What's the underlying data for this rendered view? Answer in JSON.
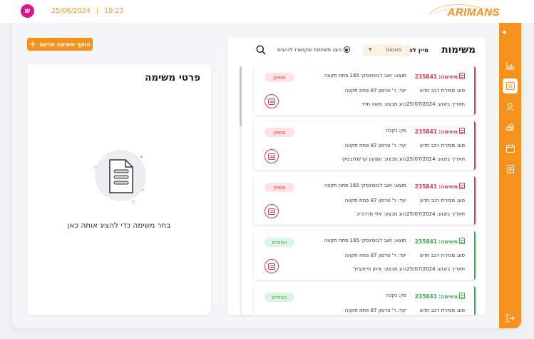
{
  "header": {
    "avatar_initial": "ש",
    "date": "25/06/2024",
    "separator": "|",
    "time": "10:23",
    "logo_text": "ARIMANS"
  },
  "actions": {
    "add_task_label": "הוסף משימה חדשה"
  },
  "details": {
    "title": "פרטי משימה",
    "empty_text": "בחר משימה כדי להציג אותה כאן"
  },
  "list": {
    "title": "משימות",
    "sort_label": "מיין לפי",
    "sort_value": "סטטוס",
    "radio_label": "הצג משימות שקושרו לנהגים"
  },
  "tasks": [
    {
      "task_label": "משימה:",
      "task_number": "235841",
      "from": "מוצא: זאב ז'בוטינסקי 165 פתח תקווה",
      "type": "סוג: מסירת רכב חדש",
      "to": "יעד: ר' טרפון 87 פתח תקווה",
      "date": "תאריך ביצוע: 25/07/2024",
      "driver": "נהג מבצע: משה חדד",
      "status": "ממתין",
      "state": "pending"
    },
    {
      "task_label": "משימה:",
      "task_number": "235841",
      "from": "מין: נקכה",
      "type": "סוג: מסירת רכב חדש",
      "to": "יעד: ר' טרפון 87 פתח תקווה",
      "date": "תאריך ביצוע: 25/07/2024",
      "driver": "נהג מבצע: שמעון קרימלובסקי",
      "status": "ממתין",
      "state": "pending"
    },
    {
      "task_label": "משימה:",
      "task_number": "235841",
      "from": "מוצא: זאב ז'בוטינסקי 165 פתח תקווה",
      "type": "סוג: מסירת רכב חדש",
      "to": "יעד: ר' טרפון 87 פתח תקווה",
      "date": "תאריך ביצוע: 25/07/2024",
      "driver": "נהג מבצע: אלי מרדכייב",
      "status": "ממתין",
      "state": "pending"
    },
    {
      "task_label": "משימה:",
      "task_number": "235841",
      "from": "מוצא: זאב ז'בוטינסקי 165 פתח תקווה",
      "type": "סוג: מסירת רכב חדש",
      "to": "יעד: ר' טרפון 87 פתח תקווה",
      "date": "תאריך ביצוע: 25/07/2024",
      "driver": "נהג מבצע: איתן חיימוביץ'",
      "status": "הסתיים",
      "state": "done"
    },
    {
      "task_label": "משימה:",
      "task_number": "235841",
      "from": "מין: נקכה",
      "type": "סוג: מסירת רכב חדש",
      "to": "יעד: ר' טרפון 87 פתח תקווה",
      "date": "",
      "driver": "",
      "status": "הסתיים",
      "state": "done"
    }
  ],
  "colors": {
    "accent": "#f5921e",
    "pending": "#d63b4d",
    "done": "#3aa94e",
    "avatar": "#d6188e"
  },
  "sidebar_icons": [
    "chart-icon",
    "tasks-icon",
    "user-icon",
    "car-search-icon",
    "calendar-icon",
    "document-icon",
    "logout-icon"
  ]
}
